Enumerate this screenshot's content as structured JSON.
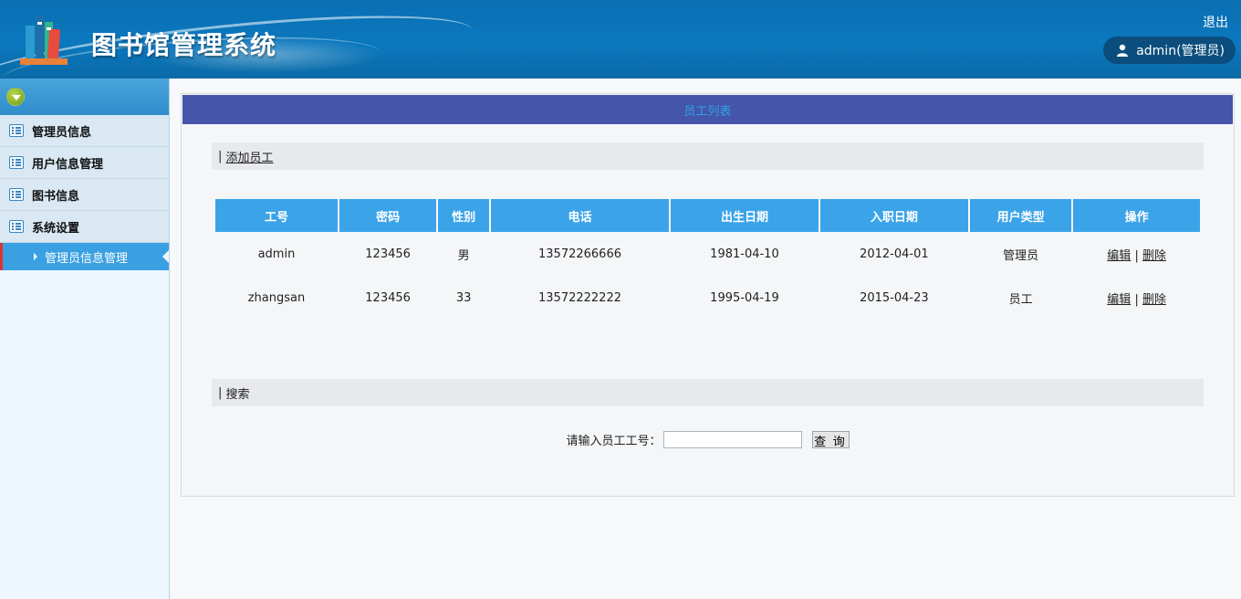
{
  "header": {
    "app_title": "图书馆管理系统",
    "logout_label": "退出",
    "user_label": "admin(管理员)"
  },
  "sidebar": {
    "items": [
      {
        "label": "管理员信息"
      },
      {
        "label": "用户信息管理"
      },
      {
        "label": "图书信息"
      },
      {
        "label": "系统设置"
      }
    ],
    "active_sub_item": "管理员信息管理"
  },
  "main": {
    "panel_title": "员工列表",
    "add_prefix": "|",
    "add_link": "添加员工",
    "table": {
      "columns": [
        "工号",
        "密码",
        "性别",
        "电话",
        "出生日期",
        "入职日期",
        "用户类型",
        "操作"
      ],
      "rows": [
        {
          "id": "admin",
          "password": "123456",
          "gender": "男",
          "phone": "13572266666",
          "birth": "1981-04-10",
          "hired": "2012-04-01",
          "type": "管理员"
        },
        {
          "id": "zhangsan",
          "password": "123456",
          "gender": "33",
          "phone": "13572222222",
          "birth": "1995-04-19",
          "hired": "2015-04-23",
          "type": "员工"
        }
      ],
      "edit_label": "编辑",
      "separator": "|",
      "delete_label": "删除"
    },
    "search": {
      "bar_prefix": "|",
      "bar_label": "搜索",
      "field_label": "请输入员工工号：",
      "input_value": "",
      "button_label": "查 询"
    }
  },
  "colors": {
    "header_blue": "#0b78be",
    "panel_head": "#4555a9",
    "table_head": "#3ba3e8",
    "sidebar_active": "#3aa0e2"
  }
}
